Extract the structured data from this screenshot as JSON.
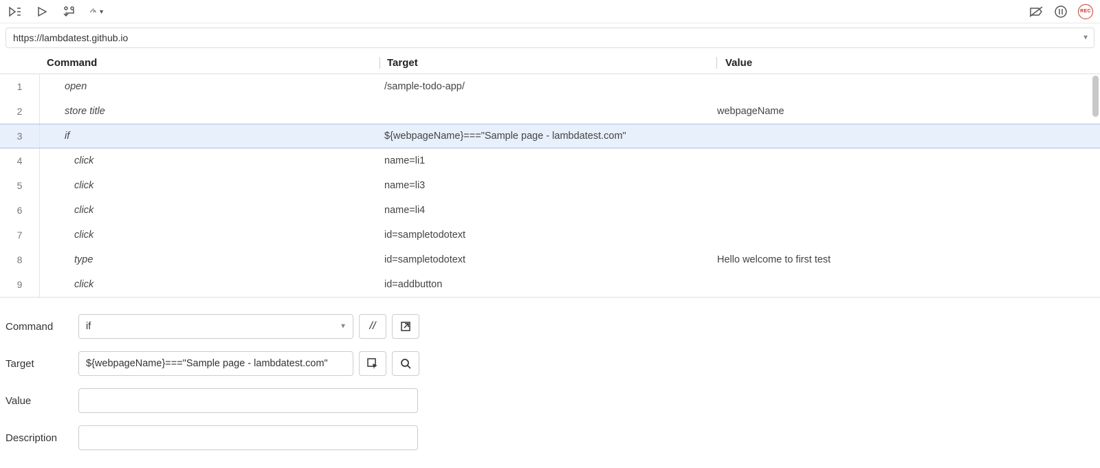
{
  "url": "https://lambdatest.github.io",
  "columns": {
    "command": "Command",
    "target": "Target",
    "value": "Value"
  },
  "rows": [
    {
      "n": "1",
      "command": "open",
      "indent": false,
      "target": "/sample-todo-app/",
      "value": ""
    },
    {
      "n": "2",
      "command": "store title",
      "indent": false,
      "target": "",
      "value": "webpageName"
    },
    {
      "n": "3",
      "command": "if",
      "indent": false,
      "target": "${webpageName}===\"Sample page - lambdatest.com\"",
      "value": "",
      "selected": true
    },
    {
      "n": "4",
      "command": "click",
      "indent": true,
      "target": "name=li1",
      "value": ""
    },
    {
      "n": "5",
      "command": "click",
      "indent": true,
      "target": "name=li3",
      "value": ""
    },
    {
      "n": "6",
      "command": "click",
      "indent": true,
      "target": "name=li4",
      "value": ""
    },
    {
      "n": "7",
      "command": "click",
      "indent": true,
      "target": "id=sampletodotext",
      "value": ""
    },
    {
      "n": "8",
      "command": "type",
      "indent": true,
      "target": "id=sampletodotext",
      "value": "Hello welcome to first test"
    },
    {
      "n": "9",
      "command": "click",
      "indent": true,
      "target": "id=addbutton",
      "value": ""
    }
  ],
  "editor": {
    "labels": {
      "command": "Command",
      "target": "Target",
      "value": "Value",
      "description": "Description"
    },
    "command": "if",
    "target": "${webpageName}===\"Sample page - lambdatest.com\"",
    "value": "",
    "description": "",
    "disable_button_glyph": "//"
  },
  "rec_label": "REC"
}
